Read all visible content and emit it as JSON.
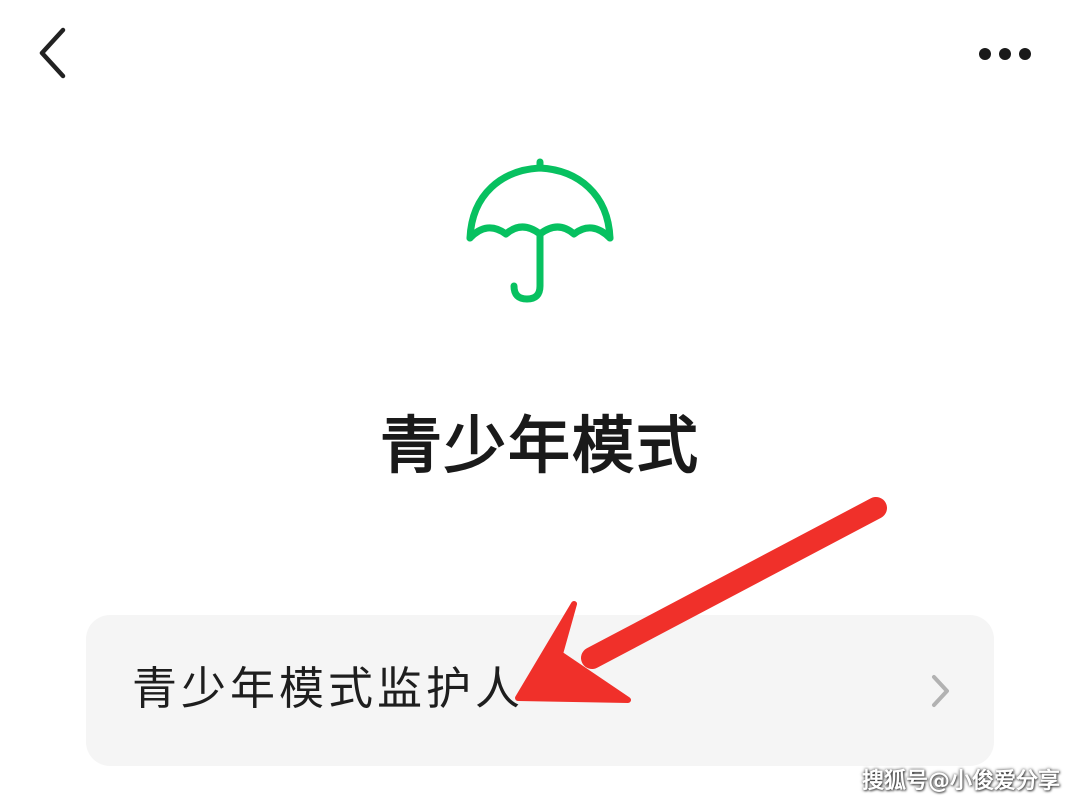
{
  "header": {
    "back_icon": "chevron-left-icon",
    "more_icon": "more-horizontal-icon"
  },
  "hero": {
    "icon": "umbrella-icon",
    "title": "青少年模式"
  },
  "menu": {
    "items": [
      {
        "label": "青少年模式监护人",
        "icon": "chevron-right-icon"
      }
    ]
  },
  "annotation": {
    "arrow_color": "#f0302a"
  },
  "watermark": {
    "text": "搜狐号@小俊爱分享"
  },
  "colors": {
    "accent": "#07c160",
    "row_background": "#f5f5f5",
    "chevron": "#b2b2b2"
  }
}
